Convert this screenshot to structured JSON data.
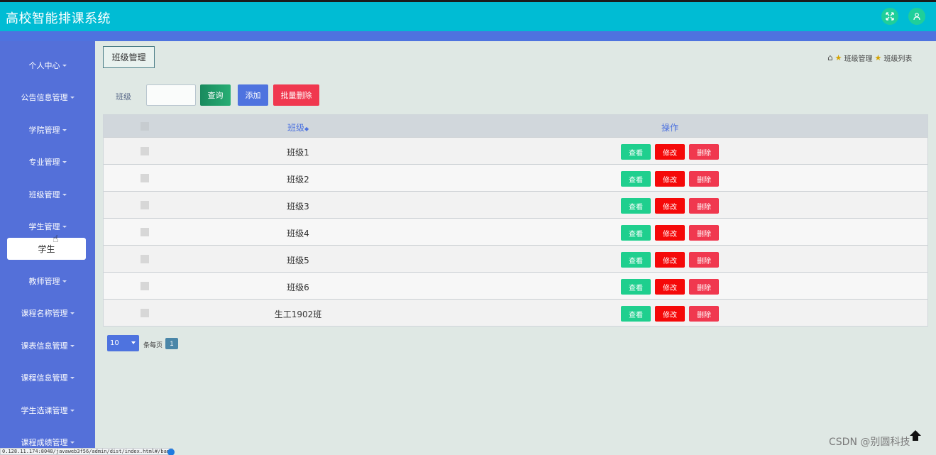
{
  "header": {
    "app_title": "高校智能排课系统",
    "fullscreen_icon": "✕",
    "user_icon": "👤"
  },
  "sidebar": {
    "items": [
      {
        "label": "个人中心"
      },
      {
        "label": "公告信息管理"
      },
      {
        "label": "学院管理"
      },
      {
        "label": "专业管理"
      },
      {
        "label": "班级管理"
      },
      {
        "label": "学生管理"
      },
      {
        "label": "教师管理"
      },
      {
        "label": "课程名称管理"
      },
      {
        "label": "课表信息管理"
      },
      {
        "label": "课程信息管理"
      },
      {
        "label": "学生选课管理"
      },
      {
        "label": "课程成绩管理"
      }
    ],
    "submenu": {
      "label": "学生"
    }
  },
  "page": {
    "tab_label": "班级管理",
    "breadcrumb": [
      "班级管理",
      "班级列表"
    ]
  },
  "search": {
    "label": "班级",
    "value": "",
    "search_button": "查询",
    "add_button": "添加",
    "batch_delete_button": "批量删除"
  },
  "table": {
    "headers": {
      "name": "班级",
      "ops": "操作"
    },
    "rows": [
      {
        "name": "班级1"
      },
      {
        "name": "班级2"
      },
      {
        "name": "班级3"
      },
      {
        "name": "班级4"
      },
      {
        "name": "班级5"
      },
      {
        "name": "班级6"
      },
      {
        "name": "生工1902班"
      }
    ],
    "ops": {
      "view": "查看",
      "edit": "修改",
      "delete": "删除"
    }
  },
  "pagination": {
    "page_size": "10",
    "per_page_label": "条每页",
    "current_page": "1"
  },
  "watermark": "CSDN @别圆科技",
  "status_url": "0.128.11.174:8048/javaweb3f56/admin/dist/index.html#/banji"
}
